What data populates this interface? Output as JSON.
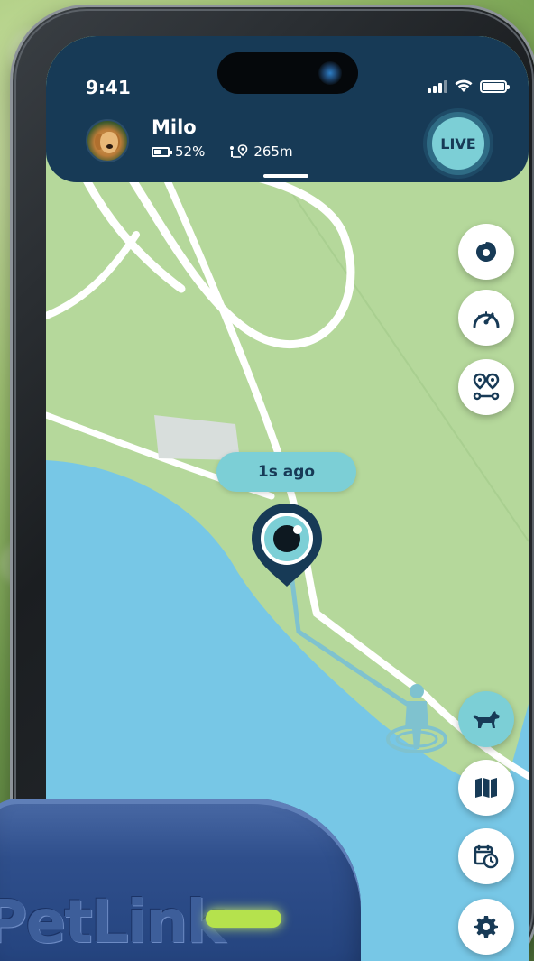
{
  "status_bar": {
    "time": "9:41"
  },
  "pet": {
    "name": "Milo",
    "battery": "52%",
    "distance": "265m"
  },
  "header": {
    "live_label": "LIVE"
  },
  "map": {
    "last_update": "1s ago"
  },
  "device": {
    "brand": "PetLink"
  },
  "icons": {
    "top_controls": [
      "drop-icon",
      "speedometer-icon",
      "route-pins-icon"
    ],
    "bottom_controls": [
      "dog-icon",
      "map-icon",
      "calendar-clock-icon",
      "gear-icon"
    ]
  },
  "colors": {
    "header_bg": "#173a56",
    "accent": "#7ccfd6",
    "land": "#b5d89b",
    "water": "#77c7e6",
    "road": "#ffffff",
    "trail": "#7fc2cf",
    "device_led": "#b5e24d"
  }
}
